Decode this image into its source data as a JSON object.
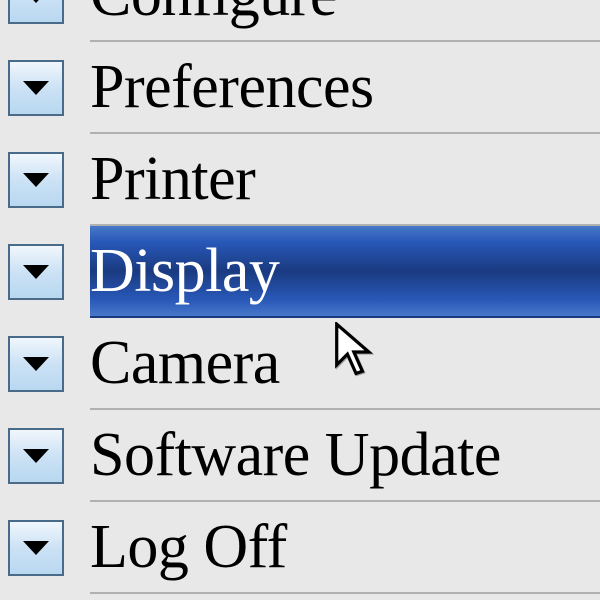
{
  "menu": {
    "items": [
      {
        "label": "Configure",
        "selected": false
      },
      {
        "label": "Preferences",
        "selected": false
      },
      {
        "label": "Printer",
        "selected": false
      },
      {
        "label": "Display",
        "selected": true
      },
      {
        "label": "Camera",
        "selected": false
      },
      {
        "label": "Software Update",
        "selected": false
      },
      {
        "label": "Log Off",
        "selected": false
      }
    ]
  }
}
